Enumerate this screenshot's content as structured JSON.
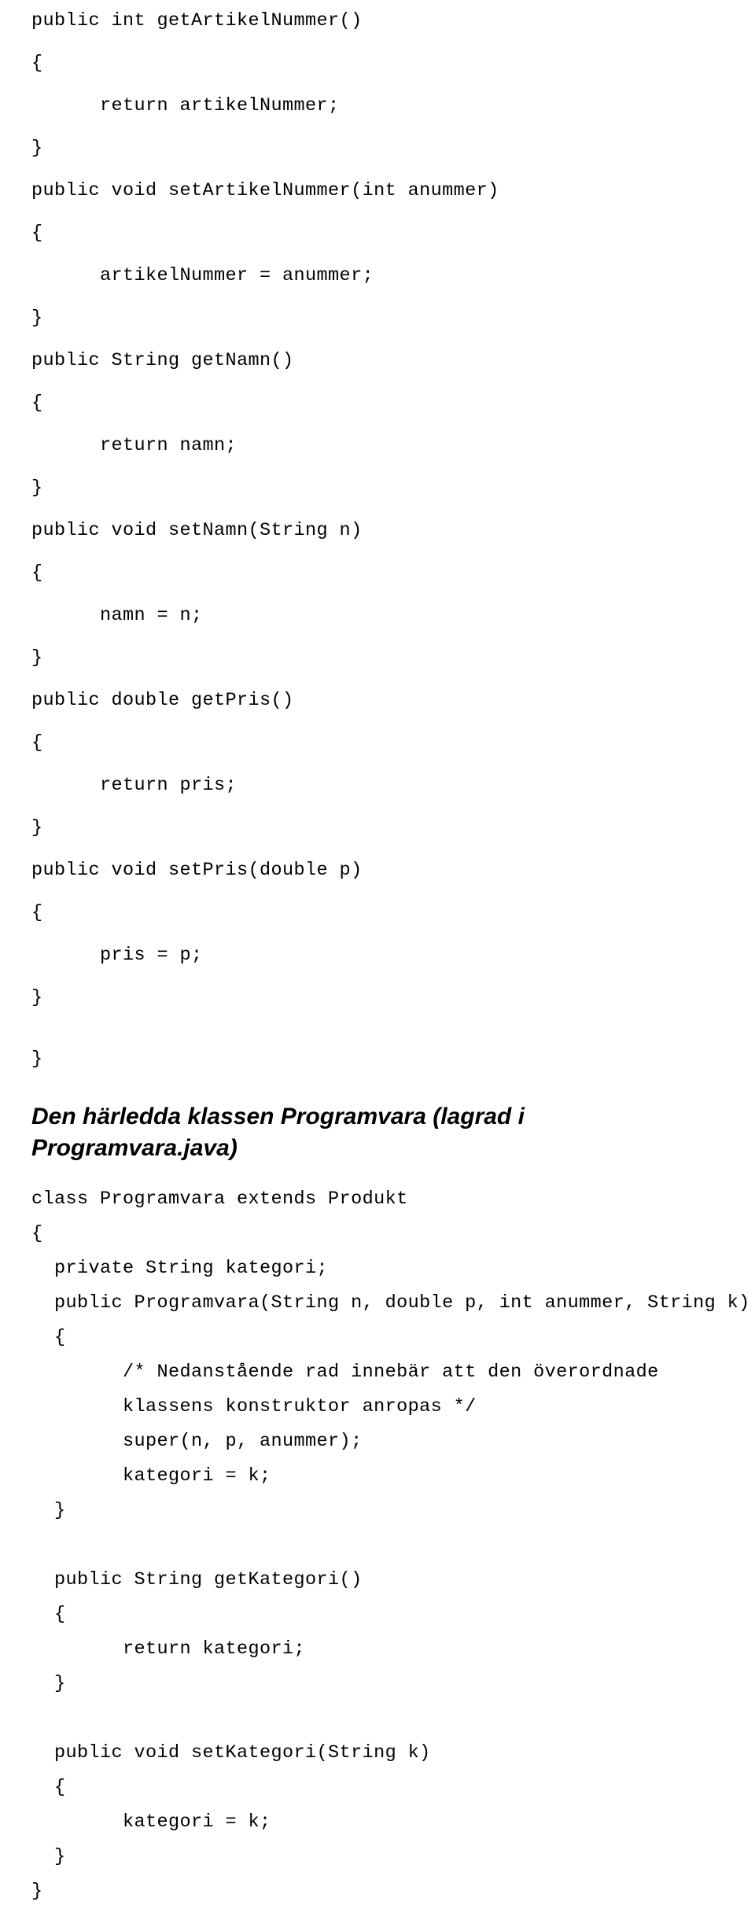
{
  "document": {
    "top_code": "public int getArtikelNummer()\n{\n      return artikelNummer;\n}\npublic void setArtikelNummer(int anummer)\n{\n      artikelNummer = anummer;\n}\npublic String getNamn()\n{\n      return namn;\n}\npublic void setNamn(String n)\n{\n      namn = n;\n}\npublic double getPris()\n{\n      return pris;\n}\npublic void setPris(double p)\n{\n      pris = p;\n}",
    "closing_brace": "}",
    "heading": "Den härledda klassen Programvara (lagrad i Programvara.java)",
    "bottom_code": "class Programvara extends Produkt\n{\n  private String kategori;\n  public Programvara(String n, double p, int anummer, String k)\n  {\n        /* Nedanstående rad innebär att den överordnade\n        klassens konstruktor anropas */\n        super(n, p, anummer);\n        kategori = k;\n  }\n\n  public String getKategori()\n  {\n        return kategori;\n  }\n\n  public void setKategori(String k)\n  {\n        kategori = k;\n  }\n}"
  }
}
